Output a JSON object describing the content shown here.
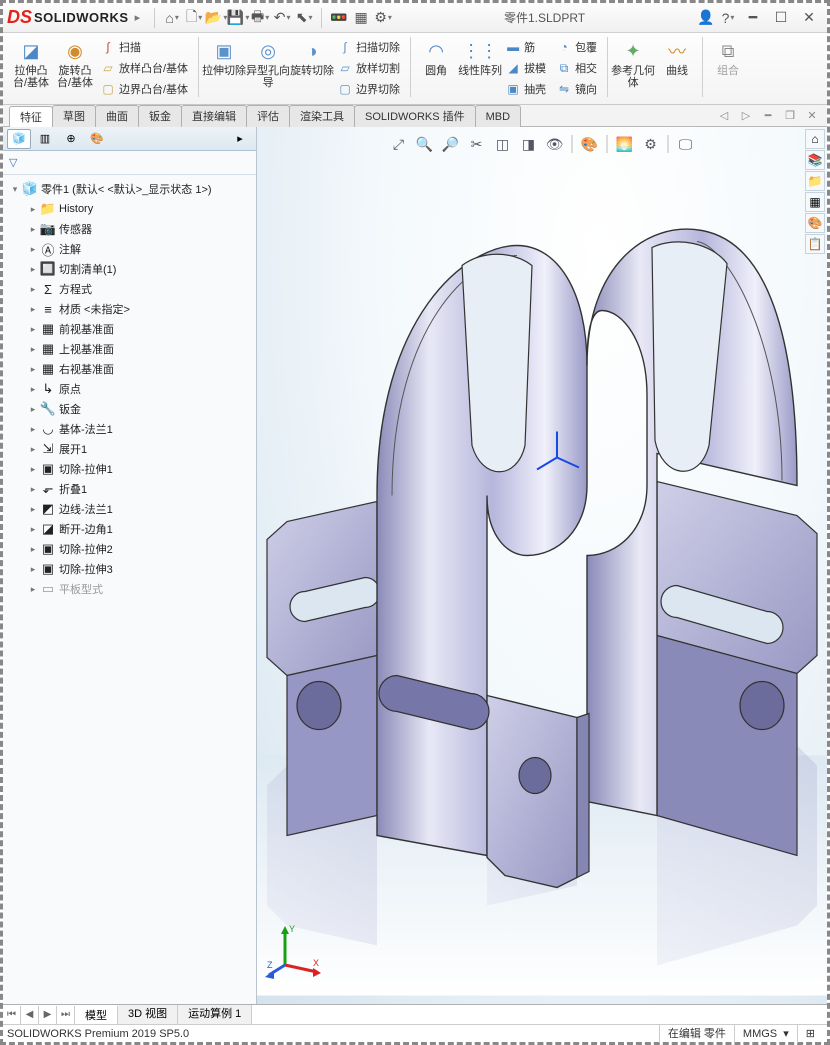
{
  "app": {
    "logo_text": "SOLIDWORKS",
    "doc_title": "零件1.SLDPRT"
  },
  "ribbon": {
    "extrude_boss": "拉伸凸台/基体",
    "revolve_boss": "旋转凸台/基体",
    "sweep": "扫描",
    "loft": "放样凸台/基体",
    "boundary": "边界凸台/基体",
    "extrude_cut": "拉伸切除",
    "hole_wizard": "异型孔向导",
    "revolve_cut": "旋转切除",
    "sweep_cut": "扫描切除",
    "loft_cut": "放样切割",
    "boundary_cut": "边界切除",
    "fillet": "圆角",
    "linear_pattern": "线性阵列",
    "rib": "筋",
    "draft": "拔模",
    "shell": "抽壳",
    "wrap": "包覆",
    "intersect": "相交",
    "mirror": "镜向",
    "ref_geometry": "参考几何体",
    "curves": "曲线",
    "combine": "组合"
  },
  "tabs": [
    "特征",
    "草图",
    "曲面",
    "钣金",
    "直接编辑",
    "评估",
    "渲染工具",
    "SOLIDWORKS 插件",
    "MBD"
  ],
  "active_tab": 0,
  "tree": {
    "root": "零件1  (默认< <默认>_显示状态 1>)",
    "items": [
      {
        "icon": "📁",
        "label": "History"
      },
      {
        "icon": "📷",
        "label": "传感器"
      },
      {
        "icon": "Ⓐ",
        "label": "注解"
      },
      {
        "icon": "🔲",
        "label": "切割清单(1)"
      },
      {
        "icon": "Σ",
        "label": "方程式"
      },
      {
        "icon": "≡",
        "label": "材质 <未指定>"
      },
      {
        "icon": "▦",
        "label": "前视基准面"
      },
      {
        "icon": "▦",
        "label": "上视基准面"
      },
      {
        "icon": "▦",
        "label": "右视基准面"
      },
      {
        "icon": "↳",
        "label": "原点"
      },
      {
        "icon": "🔧",
        "label": "钣金"
      },
      {
        "icon": "◡",
        "label": "基体-法兰1"
      },
      {
        "icon": "⇲",
        "label": "展开1"
      },
      {
        "icon": "▣",
        "label": "切除-拉伸1"
      },
      {
        "icon": "⬐",
        "label": "折叠1"
      },
      {
        "icon": "◩",
        "label": "边线-法兰1"
      },
      {
        "icon": "◪",
        "label": "断开-边角1"
      },
      {
        "icon": "▣",
        "label": "切除-拉伸2"
      },
      {
        "icon": "▣",
        "label": "切除-拉伸3"
      },
      {
        "icon": "▭",
        "label": "平板型式",
        "dim": true
      }
    ]
  },
  "bottom_tabs": [
    "模型",
    "3D 视图",
    "运动算例 1"
  ],
  "active_bottom_tab": 0,
  "status": {
    "version": "SOLIDWORKS Premium 2019 SP5.0",
    "edit": "在编辑 零件",
    "units": "MMGS"
  },
  "triad": {
    "x": "X",
    "y": "Y",
    "z": "Z"
  }
}
